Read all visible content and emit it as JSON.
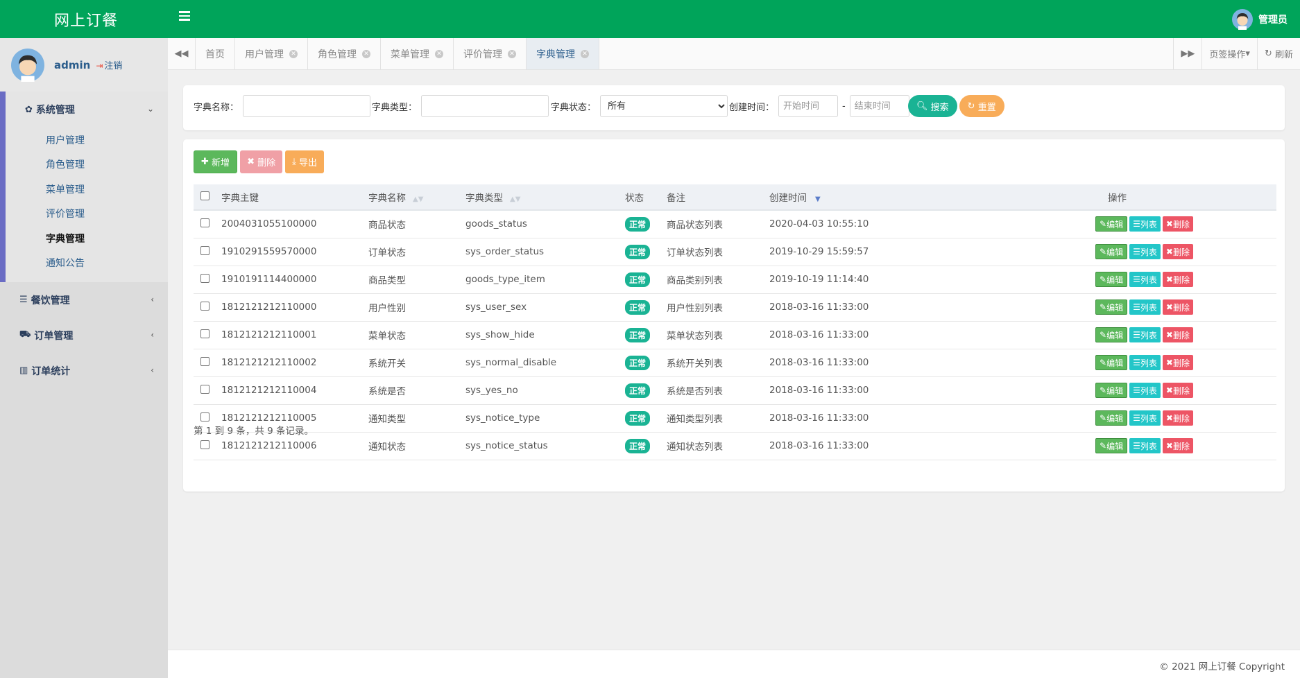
{
  "app": {
    "brand": "网上订餐",
    "user_label": "管理员"
  },
  "sidebar": {
    "profile_name": "admin",
    "logout_label": "注销",
    "groups": [
      {
        "label": "系统管理",
        "icon": "gear-icon",
        "items": [
          "用户管理",
          "角色管理",
          "菜单管理",
          "评价管理",
          "字典管理",
          "通知公告"
        ],
        "active_item": "字典管理"
      },
      {
        "label": "餐饮管理",
        "icon": "list-icon"
      },
      {
        "label": "订单管理",
        "icon": "cart-icon"
      },
      {
        "label": "订单统计",
        "icon": "bar-chart-icon"
      }
    ]
  },
  "tabs": {
    "items": [
      "首页",
      "用户管理",
      "角色管理",
      "菜单管理",
      "评价管理",
      "字典管理"
    ],
    "active": "字典管理",
    "page_ops_label": "页签操作",
    "refresh_label": "刷新"
  },
  "search": {
    "name_label": "字典名称：",
    "type_label": "字典类型：",
    "status_label": "字典状态：",
    "status_value": "所有",
    "time_label": "创建时间：",
    "start_placeholder": "开始时间",
    "end_placeholder": "结束时间",
    "range_sep": "-",
    "search_btn": "搜索",
    "reset_btn": "重置"
  },
  "toolbar": {
    "add": "新增",
    "delete": "删除",
    "export": "导出"
  },
  "table": {
    "headers": [
      "字典主键",
      "字典名称",
      "字典类型",
      "状态",
      "备注",
      "创建时间",
      "操作"
    ],
    "rows": [
      [
        "2004031055100000",
        "商品状态",
        "goods_status",
        "正常",
        "商品状态列表",
        "2020-04-03 10:55:10"
      ],
      [
        "1910291559570000",
        "订单状态",
        "sys_order_status",
        "正常",
        "订单状态列表",
        "2019-10-29 15:59:57"
      ],
      [
        "1910191114400000",
        "商品类型",
        "goods_type_item",
        "正常",
        "商品类别列表",
        "2019-10-19 11:14:40"
      ],
      [
        "1812121212110000",
        "用户性别",
        "sys_user_sex",
        "正常",
        "用户性别列表",
        "2018-03-16 11:33:00"
      ],
      [
        "1812121212110001",
        "菜单状态",
        "sys_show_hide",
        "正常",
        "菜单状态列表",
        "2018-03-16 11:33:00"
      ],
      [
        "1812121212110002",
        "系统开关",
        "sys_normal_disable",
        "正常",
        "系统开关列表",
        "2018-03-16 11:33:00"
      ],
      [
        "1812121212110004",
        "系统是否",
        "sys_yes_no",
        "正常",
        "系统是否列表",
        "2018-03-16 11:33:00"
      ],
      [
        "1812121212110005",
        "通知类型",
        "sys_notice_type",
        "正常",
        "通知类型列表",
        "2018-03-16 11:33:00"
      ],
      [
        "1812121212110006",
        "通知状态",
        "sys_notice_status",
        "正常",
        "通知状态列表",
        "2018-03-16 11:33:00"
      ]
    ],
    "row_actions": {
      "edit": "编辑",
      "list": "列表",
      "remove": "删除"
    },
    "pager_info": "第 1 到 9 条，共 9 条记录。"
  },
  "footer": {
    "copyright": "© 2021 网上订餐 Copyright"
  },
  "colors": {
    "topbar": "#00a45a",
    "badge": "#1ab394",
    "edit": "#5cb85c",
    "list": "#23c6c8",
    "remove": "#ed5565",
    "search": "#1ab394",
    "reset": "#f8ac59"
  }
}
